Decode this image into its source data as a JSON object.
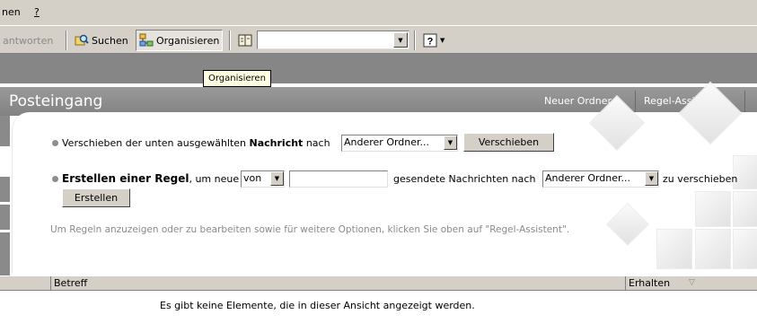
{
  "menubar": {
    "items": [
      {
        "label": "nen"
      },
      {
        "label": "?"
      }
    ]
  },
  "toolbar": {
    "reply_label": "antworten",
    "search_label": "Suchen",
    "organize_label": "Organisieren",
    "address_book_icon": "address-book-icon",
    "address_value": "",
    "help_icon": "help-icon"
  },
  "tooltip": {
    "text": "Organisieren"
  },
  "folder": {
    "title": "Posteingang",
    "links": [
      "Neuer Ordner...",
      "Regel-Assistent..."
    ]
  },
  "organize": {
    "move": {
      "prefix": "Verschieben der unten ausgewählten ",
      "bold": "Nachricht",
      "suffix": " nach",
      "folder_value": "Anderer Ordner...",
      "button": "Verschieben"
    },
    "rule": {
      "bold": "Erstellen einer Regel",
      "text1": ", um neue",
      "from_value": "von",
      "sender_value": "",
      "text2": "gesendete Nachrichten nach",
      "folder_value": "Anderer Ordner...",
      "text3": "zu verschieben",
      "button": "Erstellen"
    },
    "hint": "Um Regeln anzuzeigen oder zu bearbeiten sowie für weitere Optionen, klicken Sie oben auf \"Regel-Assistent\"."
  },
  "columns": {
    "subject": "Betreff",
    "received": "Erhalten"
  },
  "list": {
    "empty_message": "Es gibt keine Elemente, die in dieser Ansicht angezeigt werden."
  },
  "colors": {
    "toolbar_bg": "#d4d0c8",
    "header_bg": "#8c8c8c",
    "band_bg": "#868686",
    "tooltip_bg": "#ffffe1"
  }
}
